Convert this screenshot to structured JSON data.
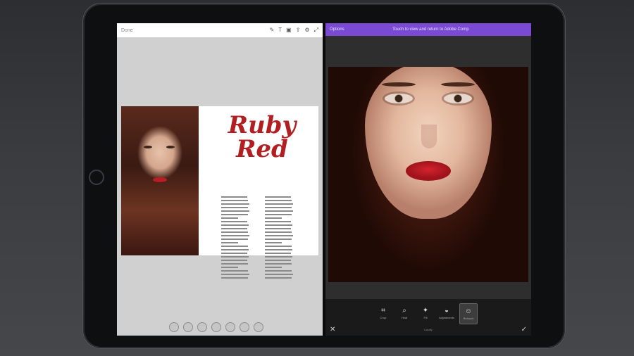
{
  "left_pane": {
    "toolbar_label": "Done",
    "toolbar_icons": [
      "brush-icon",
      "text-icon",
      "image-icon",
      "share-icon",
      "gear-icon",
      "expand-icon"
    ],
    "toolbar_glyphs": [
      "✎",
      "T",
      "▣",
      "⇪",
      "⚙",
      "⤢"
    ],
    "spread_title_line1": "Ruby",
    "spread_title_line2": "Red",
    "bottom_tools_count": 7
  },
  "right_pane": {
    "header_left": "Options",
    "header_center": "Touch to view and return to Adobe Comp",
    "tools": [
      {
        "glyph": "⌗",
        "label": "Crop",
        "icon": "crop-icon"
      },
      {
        "glyph": "⌕",
        "label": "Heal",
        "icon": "heal-icon"
      },
      {
        "glyph": "✦",
        "label": "Fill",
        "icon": "fill-icon"
      },
      {
        "glyph": "◒",
        "label": "Adjustments",
        "icon": "adjust-icon"
      },
      {
        "glyph": "☺",
        "label": "Retouch",
        "icon": "face-icon"
      }
    ],
    "active_tool_index": 4,
    "tray_caption": "Liquify",
    "close_glyph": "✕",
    "confirm_glyph": "✓"
  }
}
